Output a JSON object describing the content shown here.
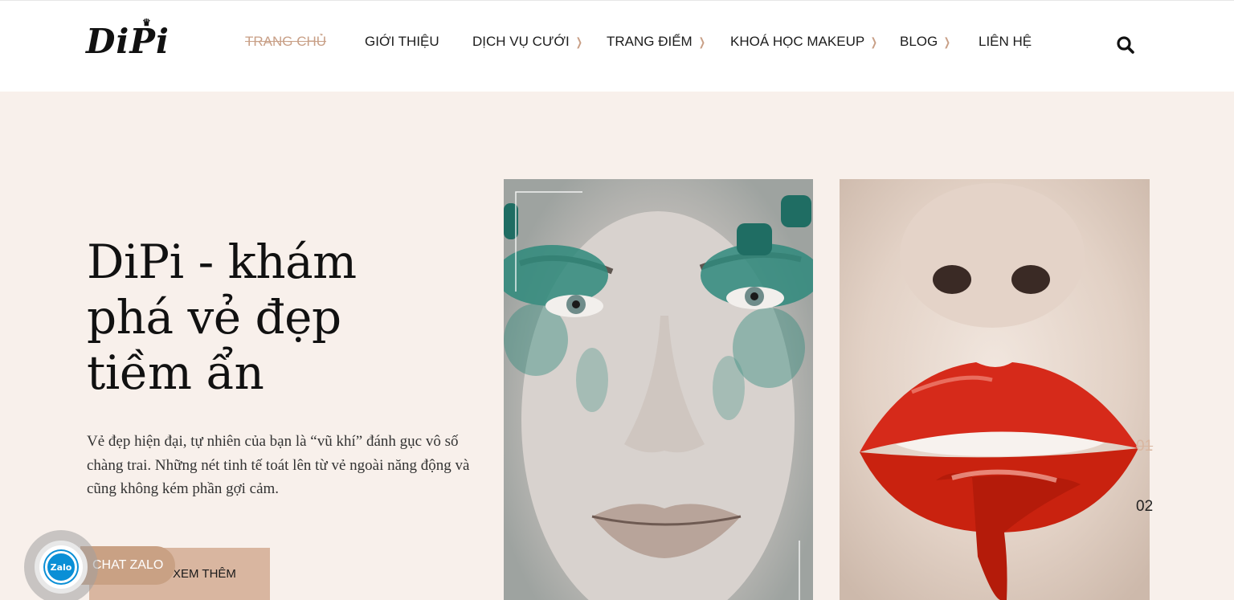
{
  "brand": {
    "logo_text": "DiPi"
  },
  "nav": {
    "items": [
      {
        "label": "TRANG CHỦ",
        "active": true,
        "has_submenu": false
      },
      {
        "label": "GIỚI THIỆU",
        "active": false,
        "has_submenu": false
      },
      {
        "label": "DỊCH VỤ CƯỚI",
        "active": false,
        "has_submenu": true
      },
      {
        "label": "TRANG ĐIỂM",
        "active": false,
        "has_submenu": true
      },
      {
        "label": "KHOÁ HỌC MAKEUP",
        "active": false,
        "has_submenu": true
      },
      {
        "label": "BLOG",
        "active": false,
        "has_submenu": true
      },
      {
        "label": "LIÊN HỆ",
        "active": false,
        "has_submenu": false
      }
    ],
    "search_icon": "search-icon"
  },
  "hero": {
    "title_lines": [
      "DiPi - khám",
      "phá vẻ đẹp",
      "tiềm ẩn"
    ],
    "description": "Vẻ đẹp hiện đại, tự nhiên của bạn là “vũ khí” đánh gục vô số chàng trai. Những nét tinh tế toát lên từ vẻ ngoài năng động và cũng không kém phần gợi cảm.",
    "button_label": "XEM THÊM"
  },
  "slider": {
    "numbers": [
      "01",
      "02"
    ],
    "active_index": 0
  },
  "zalo": {
    "icon_label": "Zalo",
    "chat_label": "CHAT ZALO"
  },
  "colors": {
    "accent": "#c89f86",
    "button": "#d9b6a0",
    "background": "#f8f0eb",
    "zalo_blue": "#0a8fd6"
  }
}
